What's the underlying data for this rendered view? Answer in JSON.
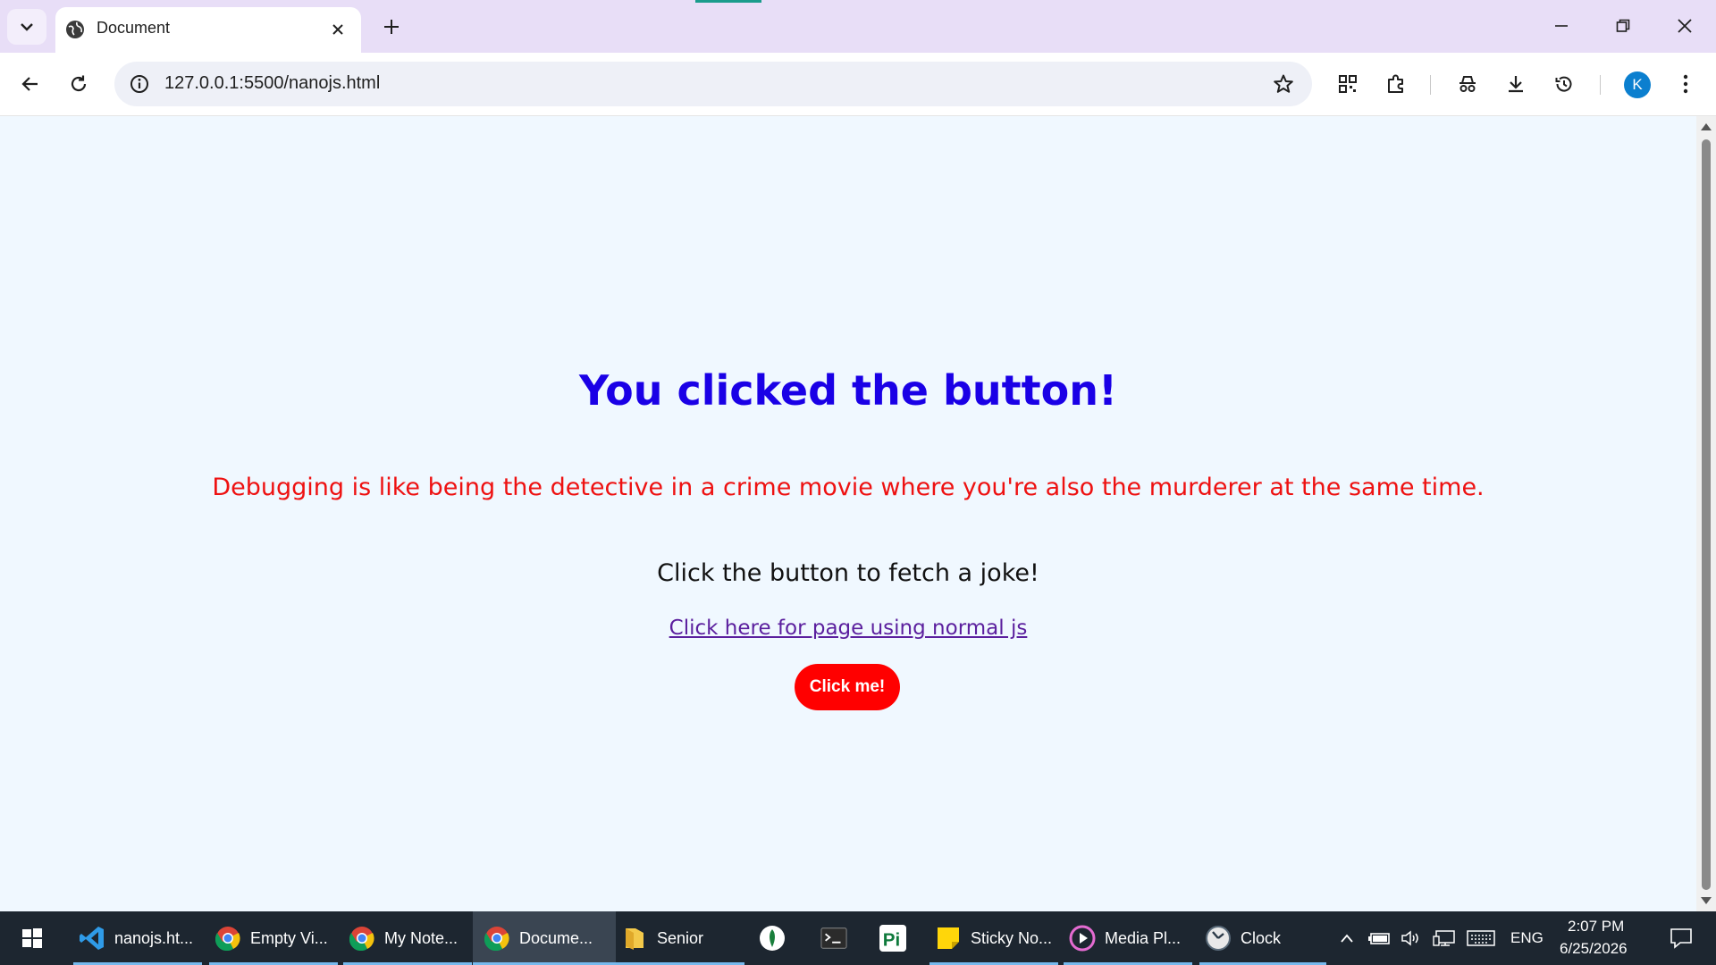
{
  "browser": {
    "tab": {
      "title": "Document"
    },
    "address_bar": {
      "url": "127.0.0.1:5500/nanojs.html"
    },
    "profile_initial": "K"
  },
  "page": {
    "heading": "You clicked the button!",
    "joke": "Debugging is like being the detective in a crime movie where you're also the murderer at the same time.",
    "prompt": "Click the button to fetch a joke!",
    "link_text": "Click here for page using normal js",
    "button_label": "Click me!"
  },
  "colors": {
    "heading": "#1a00e6",
    "joke": "#ee1111",
    "button": "#ff0000",
    "link": "#5b1f9e",
    "page_background": "#f0f8ff"
  },
  "taskbar": {
    "items": [
      {
        "label": "nanojs.ht...",
        "icon": "vscode-icon"
      },
      {
        "label": "Empty Vi...",
        "icon": "chrome-icon"
      },
      {
        "label": "My Note...",
        "icon": "chrome-icon"
      },
      {
        "label": "Docume...",
        "icon": "chrome-icon",
        "active": true
      },
      {
        "label": "Senior",
        "icon": "folder-icon"
      },
      {
        "label": "",
        "icon": "mongodb-icon"
      },
      {
        "label": "",
        "icon": "terminal-icon"
      },
      {
        "label": "",
        "icon": "pi-icon"
      },
      {
        "label": "Sticky No...",
        "icon": "sticky-notes-icon"
      },
      {
        "label": "Media Pl...",
        "icon": "media-player-icon"
      },
      {
        "label": "Clock",
        "icon": "clock-icon"
      }
    ],
    "tray": {
      "language": "ENG",
      "time": "2:07 PM",
      "date": "6/25/2026"
    }
  }
}
